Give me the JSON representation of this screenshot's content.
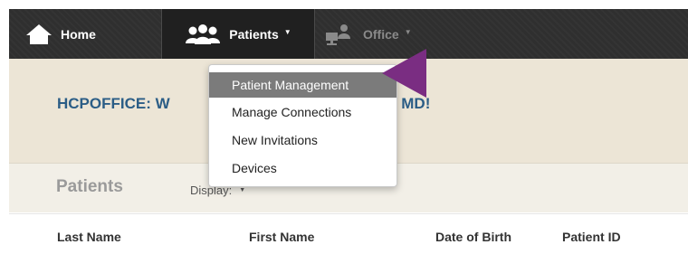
{
  "nav": {
    "home_label": "Home",
    "patients_label": "Patients",
    "office_label": "Office",
    "icons": [
      "home-icon",
      "patients-group-icon",
      "office-icon"
    ]
  },
  "banner": {
    "welcome_left": "HCPOFFICE: W",
    "welcome_right": "nett, MD!"
  },
  "patients_menu": {
    "items": [
      "Patient Management",
      "Manage Connections",
      "New Invitations",
      "Devices"
    ],
    "active_index": 0
  },
  "section": {
    "title": "Patients",
    "display_label": "Display:"
  },
  "table": {
    "columns": [
      "Last Name",
      "First Name",
      "Date of Birth",
      "Patient ID"
    ]
  },
  "colors": {
    "nav_bg": "#2f2f2f",
    "banner_bg": "#ece5d6",
    "welcome_text": "#2b5d86",
    "menu_active_bg": "#7b7b7b",
    "pointer_arrow": "#7a2d82"
  }
}
